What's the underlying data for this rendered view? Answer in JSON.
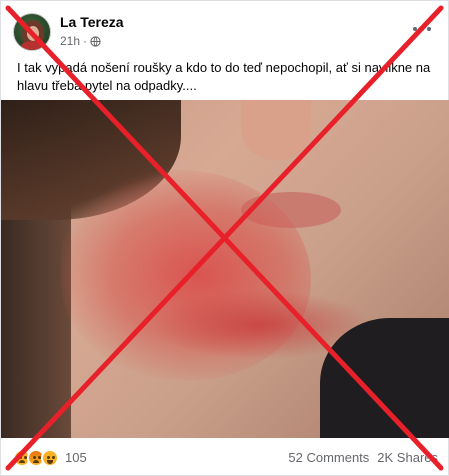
{
  "post": {
    "author": "La Tereza",
    "time": "21h",
    "time_separator": "·",
    "privacy_icon": "globe-icon",
    "caption": "I tak vypadá nošení roušky a kdo to do teď nepochopil, ať si navlikne na hlavu třeba pytel na odpadky....",
    "reactions": {
      "icons": [
        "sad-reaction-icon",
        "angry-reaction-icon",
        "haha-reaction-icon"
      ],
      "count": "105"
    },
    "comments": "52 Comments",
    "shares": "2K Shares"
  },
  "overlay": {
    "type": "red-cross",
    "color": "#e8202a"
  }
}
